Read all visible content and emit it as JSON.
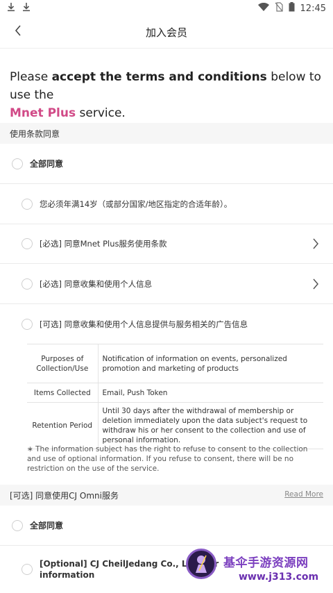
{
  "statusbar": {
    "time": "12:45"
  },
  "header": {
    "title": "加入会员"
  },
  "intro": {
    "part1": "Please ",
    "bold": "accept the terms and conditions",
    "part2": " below to use the",
    "brand": "Mnet Plus",
    "part3": " service."
  },
  "section1": {
    "title": "使用条款同意"
  },
  "rows": {
    "all_agree": "全部同意",
    "age": "您必须年满14岁（或部分国家/地区指定的合适年龄）。",
    "terms": "[必选] 同意Mnet Plus服务使用条款",
    "privacy": "[必选] 同意收集和使用个人信息",
    "ads": "[可选] 同意收集和使用个人信息提供与服务相关的广告信息"
  },
  "info_table": [
    {
      "key": "Purposes of Collection/Use",
      "value": "Notification of information on events, personalized promotion and marketing of products"
    },
    {
      "key": "Items Collected",
      "value": "Email, Push Token"
    },
    {
      "key": "Retention Period",
      "value": "Until 30 days after the withdrawal of membership or deletion immediately upon the data subject's request to withdraw his or her consent to the collection and use of personal information."
    }
  ],
  "note": "∗ The information subject has the right to refuse to consent to the collection and use of optional information. If you refuse to consent, there will be no restriction on the use of the service.",
  "section2": {
    "title": "[可选] 同意使用CJ Omni服务",
    "read_more": "Read More"
  },
  "rows2": {
    "all_agree": "全部同意",
    "cj": "[Optional] CJ CheilJedang Co., Ltd. agr",
    "cj_line2": "information"
  },
  "watermark": {
    "title": "基伞手游资源网",
    "url": "www.j313.com"
  }
}
